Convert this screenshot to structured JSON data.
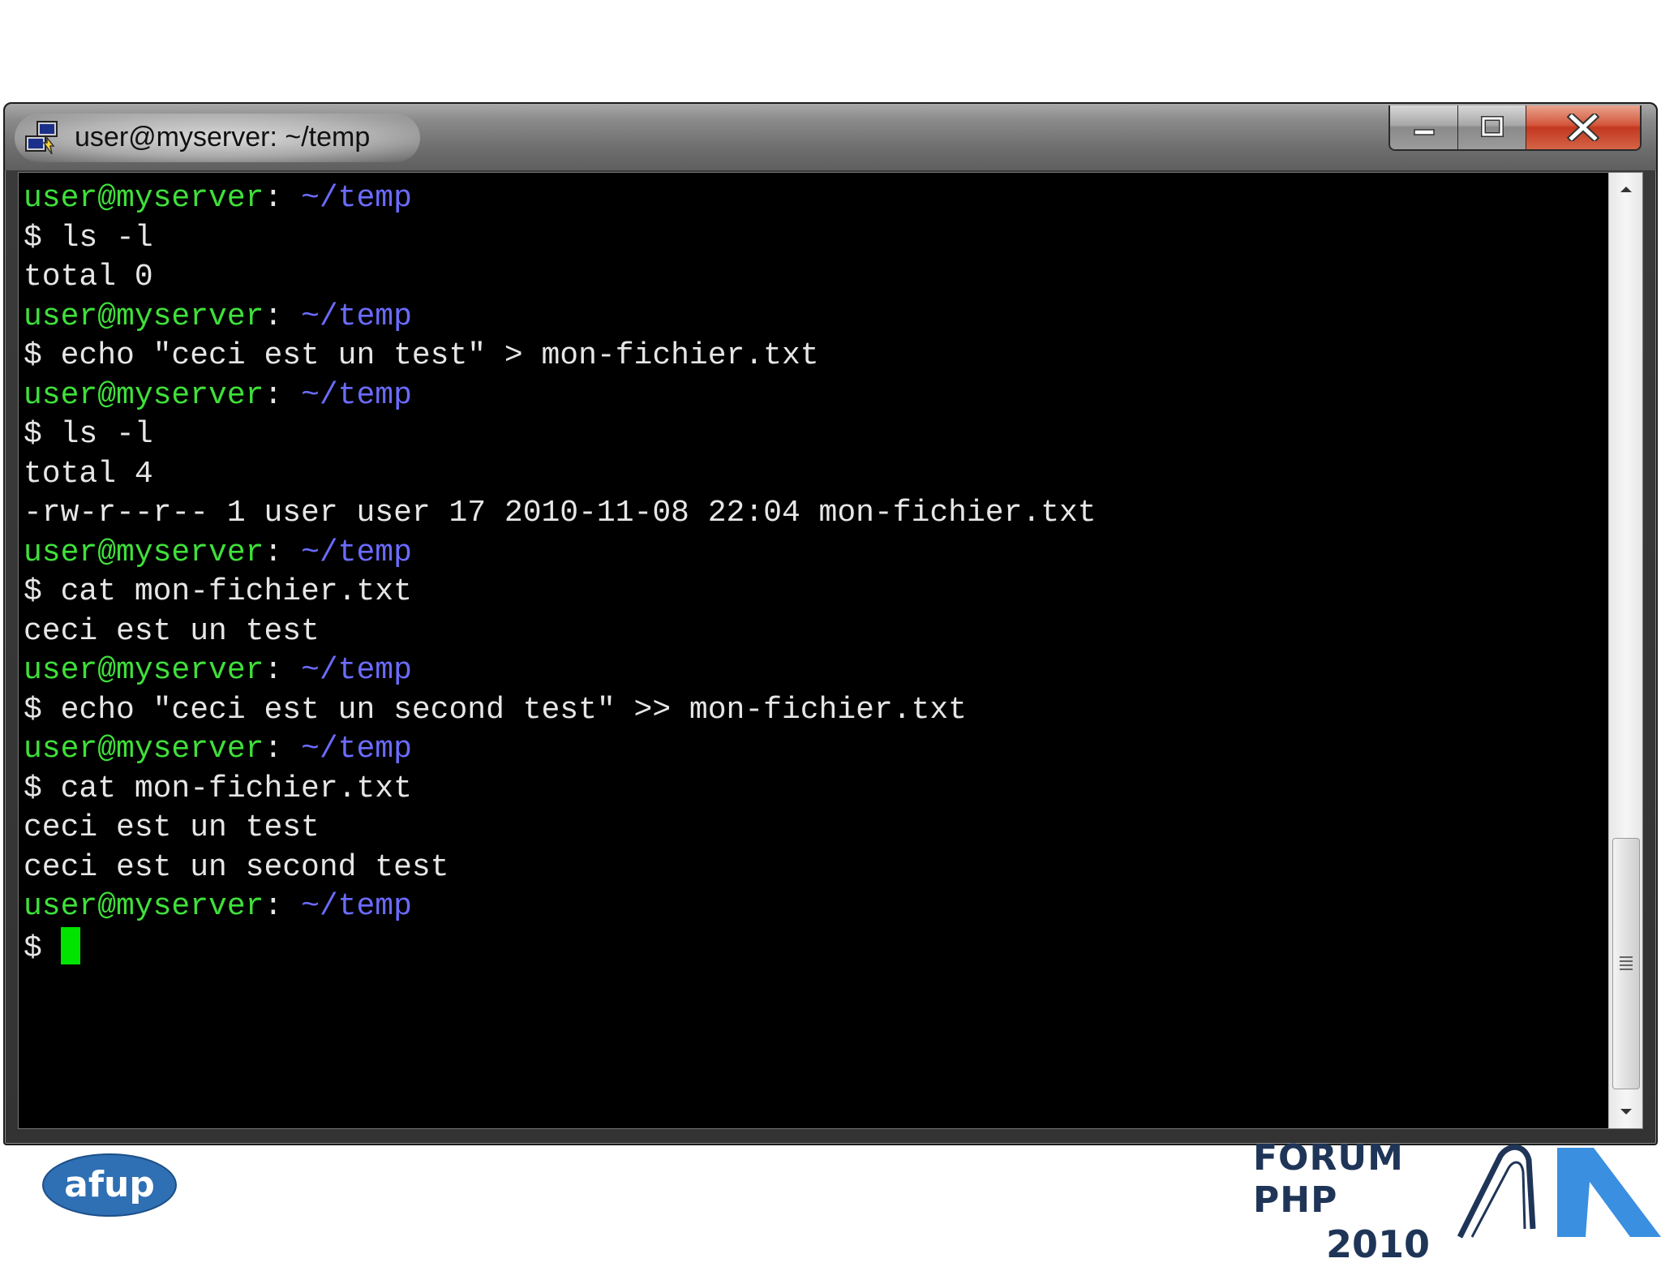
{
  "window": {
    "title": "user@myserver: ~/temp",
    "buttons": {
      "minimize_icon": "minimize-icon",
      "maximize_icon": "maximize-icon",
      "close_icon": "close-icon"
    }
  },
  "terminal": {
    "colors": {
      "background": "#000000",
      "text": "#e6e6e6",
      "prompt_user": "#3fe03a",
      "prompt_path": "#6b6bff",
      "cursor": "#00e400"
    },
    "lines": [
      {
        "type": "prompt",
        "user": "user@myserver",
        "sep": ": ",
        "path": "~/temp"
      },
      {
        "type": "text",
        "text": "$ ls -l"
      },
      {
        "type": "text",
        "text": "total 0"
      },
      {
        "type": "prompt",
        "user": "user@myserver",
        "sep": ": ",
        "path": "~/temp"
      },
      {
        "type": "text",
        "text": "$ echo \"ceci est un test\" > mon-fichier.txt"
      },
      {
        "type": "prompt",
        "user": "user@myserver",
        "sep": ": ",
        "path": "~/temp"
      },
      {
        "type": "text",
        "text": "$ ls -l"
      },
      {
        "type": "text",
        "text": "total 4"
      },
      {
        "type": "text",
        "text": "-rw-r--r-- 1 user user 17 2010-11-08 22:04 mon-fichier.txt"
      },
      {
        "type": "prompt",
        "user": "user@myserver",
        "sep": ": ",
        "path": "~/temp"
      },
      {
        "type": "text",
        "text": "$ cat mon-fichier.txt"
      },
      {
        "type": "text",
        "text": "ceci est un test"
      },
      {
        "type": "prompt",
        "user": "user@myserver",
        "sep": ": ",
        "path": "~/temp"
      },
      {
        "type": "text",
        "text": "$ echo \"ceci est un second test\" >> mon-fichier.txt"
      },
      {
        "type": "prompt",
        "user": "user@myserver",
        "sep": ": ",
        "path": "~/temp"
      },
      {
        "type": "text",
        "text": "$ cat mon-fichier.txt"
      },
      {
        "type": "text",
        "text": "ceci est un test"
      },
      {
        "type": "text",
        "text": "ceci est un second test"
      },
      {
        "type": "prompt",
        "user": "user@myserver",
        "sep": ": ",
        "path": "~/temp"
      },
      {
        "type": "input",
        "text": "$ "
      }
    ]
  },
  "footer": {
    "afup_logo_text": "afup",
    "afup_color": "#2f6fb3",
    "forum_name": "FORUM PHP",
    "forum_year": "2010",
    "forum_color": "#1f3558",
    "forum_accent": "#3a8fe0"
  }
}
